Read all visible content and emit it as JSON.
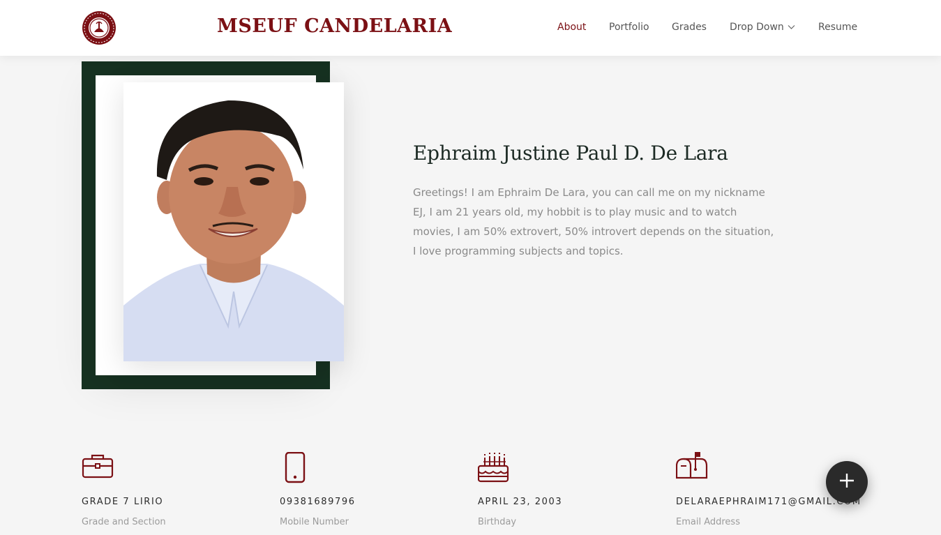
{
  "header": {
    "brand": "MSEUF CANDELARIA",
    "nav": [
      {
        "label": "About",
        "active": true
      },
      {
        "label": "Portfolio",
        "active": false
      },
      {
        "label": "Grades",
        "active": false
      },
      {
        "label": "Drop Down",
        "active": false,
        "icon": "chevron-down-icon"
      },
      {
        "label": "Resume",
        "active": false
      }
    ]
  },
  "about": {
    "name": "Ephraim Justine Paul D. De Lara",
    "bio": "Greetings! I am Ephraim De Lara, you can call me on my nickname EJ, I am 21 years old, my hobbit is to play music and to watch movies, I am 50% extrovert, 50% introvert depends on the situation, I love programming subjects and topics."
  },
  "info": [
    {
      "icon": "briefcase-icon",
      "value": "GRADE 7 LIRIO",
      "label": "Grade and Section"
    },
    {
      "icon": "mobile-phone-icon",
      "value": "09381689796",
      "label": "Mobile Number"
    },
    {
      "icon": "birthday-cake-icon",
      "value": "APRIL 23, 2003",
      "label": "Birthday"
    },
    {
      "icon": "mailbox-icon",
      "value": "DELARAEPHRAIM171@GMAIL.COM",
      "label": "Email Address"
    }
  ],
  "fab": {
    "icon": "plus-icon"
  },
  "colors": {
    "brand": "#7b1014",
    "frame": "#173222",
    "background": "#f5f5f5",
    "fab": "#2a2a2a"
  }
}
